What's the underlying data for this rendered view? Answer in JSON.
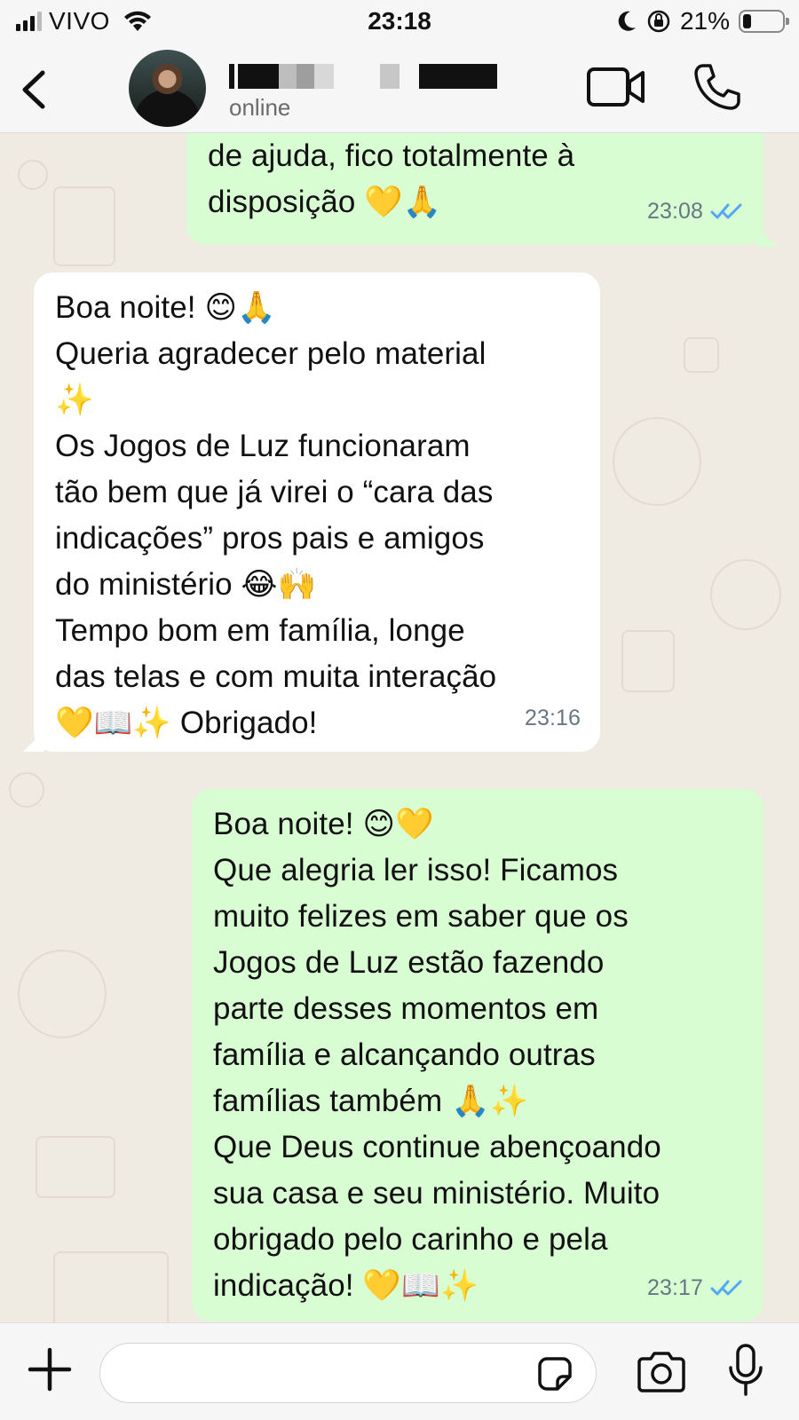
{
  "status_bar": {
    "carrier": "VIVO",
    "time": "23:18",
    "battery": "21%",
    "battery_level": 0.21
  },
  "header": {
    "contact_status": "online",
    "icons": [
      "back-chevron-icon",
      "video-call-icon",
      "phone-call-icon"
    ]
  },
  "messages": [
    {
      "direction": "outgoing",
      "lines": [
        "de ajuda, fico totalmente à",
        "disposição 💛🙏"
      ],
      "time": "23:08",
      "read": true
    },
    {
      "direction": "incoming",
      "lines": [
        "Boa noite! 😊🙏",
        "Queria agradecer pelo material",
        "✨",
        "Os Jogos de Luz funcionaram",
        "tão bem que já virei o “cara das",
        "indicações” pros pais e amigos",
        "do ministério 😂🙌",
        "Tempo bom em família, longe",
        "das telas e com muita interação",
        "💛📖✨ Obrigado!"
      ],
      "time": "23:16"
    },
    {
      "direction": "outgoing",
      "lines": [
        "Boa noite! 😊💛",
        "Que alegria ler isso! Ficamos",
        "muito felizes em saber que os",
        "Jogos de Luz estão fazendo",
        "parte desses momentos em",
        "família e alcançando outras",
        "famílias também 🙏✨",
        "Que Deus continue abençoando",
        "sua casa e seu ministério. Muito",
        "obrigado pelo carinho e pela",
        "indicação! 💛📖✨"
      ],
      "time": "23:17",
      "read": true
    }
  ],
  "input_bar": {
    "placeholder": "",
    "icons": [
      "plus-icon",
      "sticker-icon",
      "camera-icon",
      "microphone-icon"
    ]
  },
  "colors": {
    "outgoing_bubble": "#d9fdd3",
    "incoming_bubble": "#ffffff",
    "chat_background": "#efeae2",
    "read_ticks": "#53a7f5"
  }
}
